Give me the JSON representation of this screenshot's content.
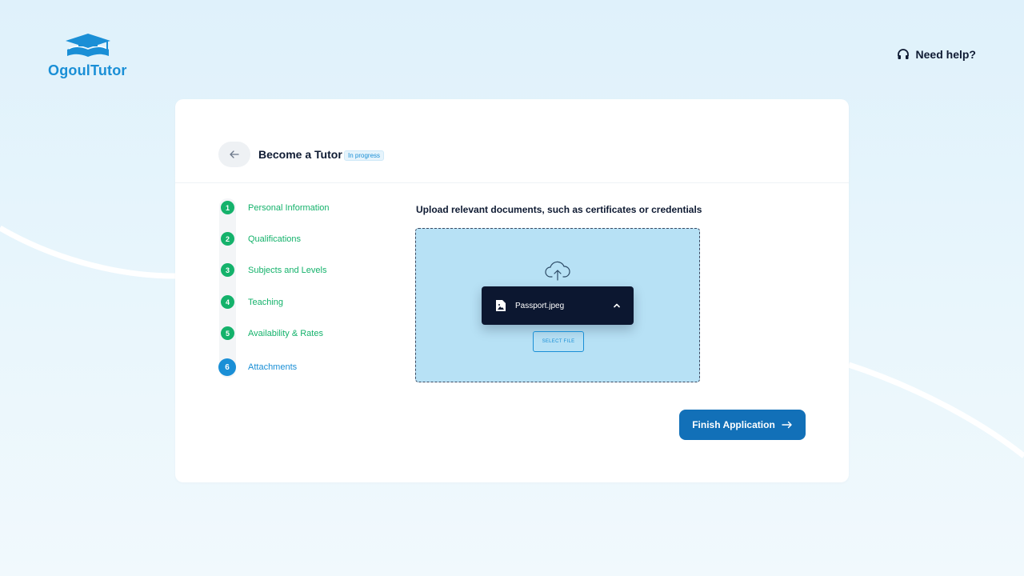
{
  "brand": {
    "name": "OgoulTutor",
    "color": "#1a8fd6"
  },
  "header": {
    "help_label": "Need help?",
    "help_icon": "headset-icon"
  },
  "application": {
    "title": "Become a Tutor",
    "status": "In progress",
    "back_icon": "arrow-left-icon"
  },
  "steps": [
    {
      "number": "1",
      "label": "Personal Information",
      "state": "done"
    },
    {
      "number": "2",
      "label": "Qualifications",
      "state": "done"
    },
    {
      "number": "3",
      "label": "Subjects and Levels",
      "state": "done"
    },
    {
      "number": "4",
      "label": "Teaching",
      "state": "done"
    },
    {
      "number": "5",
      "label": "Availability & Rates",
      "state": "done"
    },
    {
      "number": "6",
      "label": "Attachments",
      "state": "active"
    }
  ],
  "upload": {
    "title": "Upload relevant documents, such as certificates or credentials",
    "upload_icon": "cloud-upload-icon",
    "file": {
      "name": "Passport.jpeg",
      "icon": "image-file-icon",
      "toggle_icon": "chevron-up-icon"
    },
    "select_file_label": "SELECT FILE"
  },
  "actions": {
    "finish_label": "Finish Application",
    "finish_icon": "arrow-right-icon"
  },
  "colors": {
    "step_done": "#14b26b",
    "step_active": "#1a8fd6",
    "primary_button": "#1270b8",
    "dropzone": "#b7e1f5",
    "file_chip": "#0c1730"
  }
}
